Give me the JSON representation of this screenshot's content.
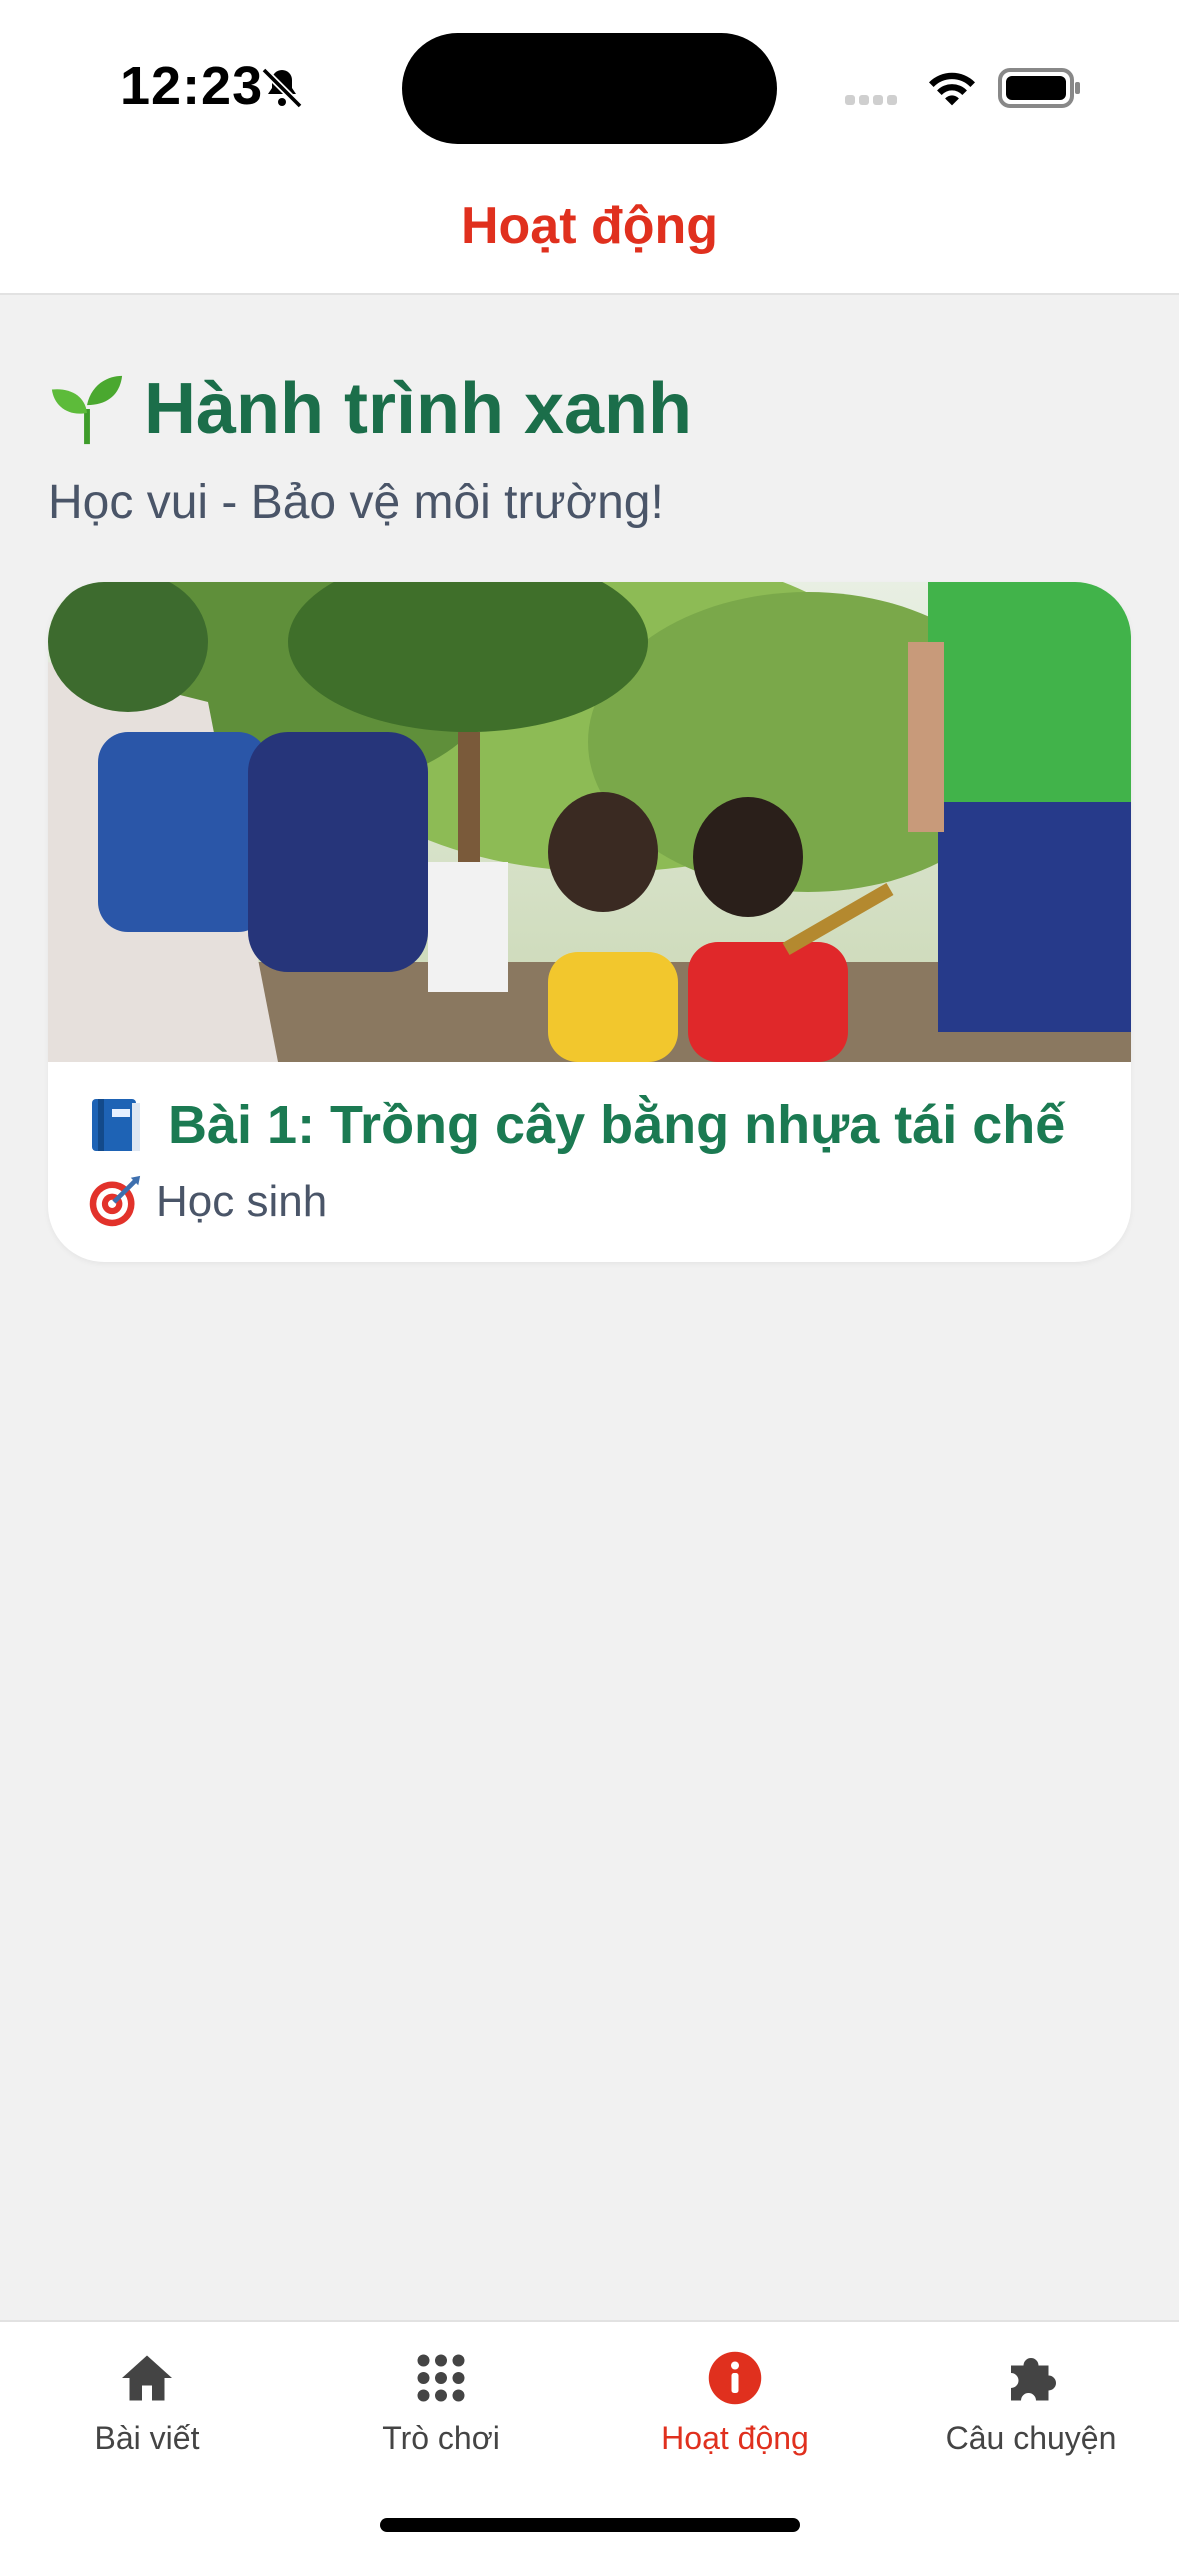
{
  "status_bar": {
    "time": "12:23"
  },
  "header": {
    "title": "Hoạt động"
  },
  "hero": {
    "title": "Hành trình xanh",
    "subtitle": "Học vui - Bảo vệ môi trường!"
  },
  "card": {
    "title": "Bài 1: Trồng cây bằng nhựa tái chế",
    "audience": "Học sinh"
  },
  "tabs": [
    {
      "label": "Bài viết",
      "icon": "home-icon"
    },
    {
      "label": "Trò chơi",
      "icon": "grid-icon"
    },
    {
      "label": "Hoạt động",
      "icon": "info-icon",
      "active": true
    },
    {
      "label": "Câu chuyện",
      "icon": "puzzle-icon"
    }
  ],
  "colors": {
    "accent": "#e0301e",
    "green": "#1b6e4a",
    "background": "#f1f1f1"
  }
}
